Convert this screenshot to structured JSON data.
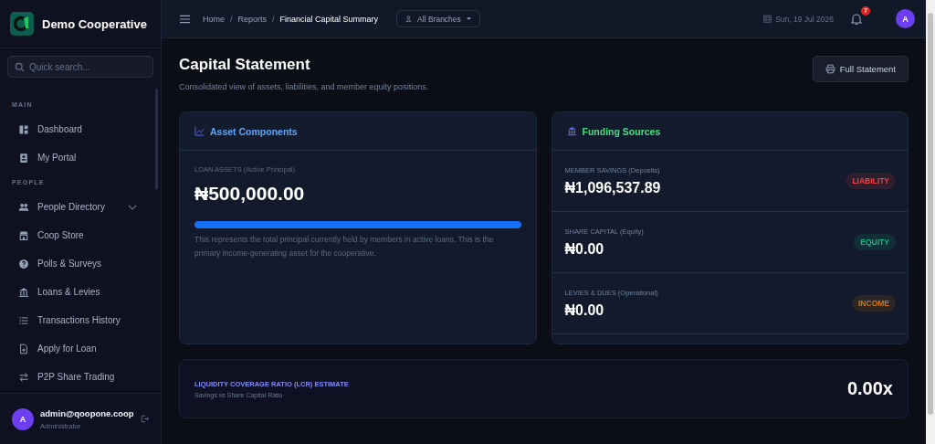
{
  "sidebar": {
    "brand": "Demo Cooperative",
    "search": {
      "placeholder": "Quick search..."
    },
    "sections": [
      {
        "label": "MAIN",
        "items": [
          {
            "label": "Dashboard",
            "kind": "link"
          },
          {
            "label": "My Portal",
            "kind": "link"
          }
        ]
      },
      {
        "label": "PEOPLE",
        "items": [
          {
            "label": "People Directory",
            "kind": "group"
          },
          {
            "label": "Coop Store",
            "kind": "link"
          },
          {
            "label": "Polls & Surveys",
            "kind": "link"
          },
          {
            "label": "Loans & Levies",
            "kind": "link"
          },
          {
            "label": "Transactions History",
            "kind": "link"
          },
          {
            "label": "Apply for Loan",
            "kind": "link"
          },
          {
            "label": "P2P Share Trading",
            "kind": "link"
          }
        ]
      }
    ],
    "user": {
      "avatar": "A",
      "email": "admin@qoopone.coop",
      "role": "Administrator"
    }
  },
  "topbar": {
    "breadcrumbs": [
      {
        "kind": "link",
        "label": "Home"
      },
      {
        "kind": "separator",
        "label": "/"
      },
      {
        "kind": "link",
        "label": "Reports"
      },
      {
        "kind": "separator",
        "label": "/"
      },
      {
        "kind": "current",
        "label": "Financial Capital Summary"
      }
    ],
    "branch": "All Branches",
    "date": "Sun, 19 Jul 2026",
    "notifications": "7",
    "avatar": "A"
  },
  "page": {
    "title": "Capital Statement",
    "subtitle": "Consolidated view of assets, liabilities, and member equity positions.",
    "action": "Full Statement"
  },
  "asset_card": {
    "title": "Asset Components",
    "label": "LOAN ASSETS (Active Principal)",
    "amount": "₦500,000.00",
    "level": 1,
    "note": "This represents the total principal currently held by members in active loans. This is the primary income-generating asset for the cooperative."
  },
  "funding_card": {
    "title": "Funding Sources",
    "rows": [
      {
        "label": "MEMBER SAVINGS (Deposits)",
        "amount": "₦1,096,537.89",
        "tag": "LIABILITY",
        "color": "#ef4444"
      },
      {
        "label": "SHARE CAPITAL (Equity)",
        "amount": "₦0.00",
        "tag": "EQUITY",
        "color": "#10b981"
      },
      {
        "label": "LEVIES & DUES (Operational)",
        "amount": "₦0.00",
        "tag": "INCOME",
        "color": "#d97706"
      }
    ]
  },
  "lcr_card": {
    "title": "LIQUIDITY COVERAGE RATIO (LCR) ESTIMATE",
    "subtitle": "Savings vs Share Capital Ratio",
    "value": "0.00x"
  }
}
